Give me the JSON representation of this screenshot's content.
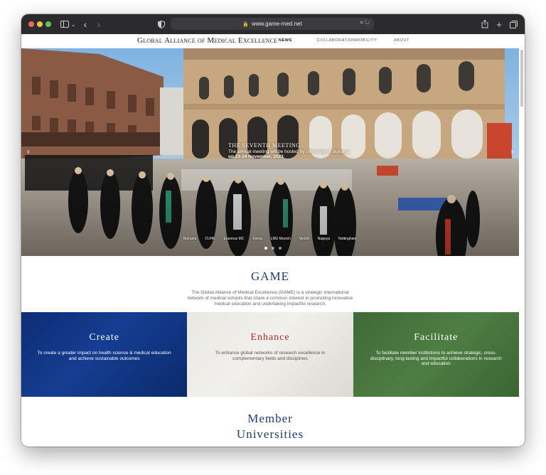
{
  "browser": {
    "url": "www.game-med.net",
    "colors": {
      "close": "#ed6a5e",
      "minimize": "#f5bf4f",
      "zoom": "#61c554"
    }
  },
  "site": {
    "logo": "Global Alliance of Medical Excellence",
    "nav": [
      "News",
      "Collaboration",
      "Mobility",
      "About"
    ]
  },
  "hero": {
    "heading": "The Seventh Meeting",
    "text": "The annual meeting will be hosted by University of Bologna",
    "date_line": "on 23-24 November, 2023",
    "ticker": [
      "Bologna",
      "CUHK",
      "Erasmus MC",
      "Korea",
      "LMU Munich",
      "McGill",
      "Nagoya",
      "Nottingham"
    ],
    "slide_count": 3,
    "active_slide": 1
  },
  "intro": {
    "title": "GAME",
    "description": "The Global Alliance of Medical Excellence (GAME) is a strategic international network of medical schools that share a common interest in promoting innovative medical education and undertaking impactful research."
  },
  "pillars": [
    {
      "title": "Create",
      "text": "To create a greater impact on health science & medical education and achieve sustainable outcomes",
      "title_color": "#ffffff",
      "text_color": "#ffffff"
    },
    {
      "title": "Enhance",
      "text": "To enhance global networks of research excellence in complementary fields and disciplines",
      "title_color": "#b22a22",
      "text_color": "#555555"
    },
    {
      "title": "Facilitate",
      "text": "To facilitate member institutions to achieve strategic, cross-disciplinary, long-lasting and impactful collaborations in research and education",
      "title_color": "#ffffff",
      "text_color": "#ffffff"
    }
  ],
  "members": {
    "title_line1": "Member",
    "title_line2": "Universities"
  },
  "colors": {
    "navy": "#1f3b6e",
    "blue_panel": "#12388a",
    "green_panel": "#487a3f",
    "red_accent": "#b22a22"
  }
}
